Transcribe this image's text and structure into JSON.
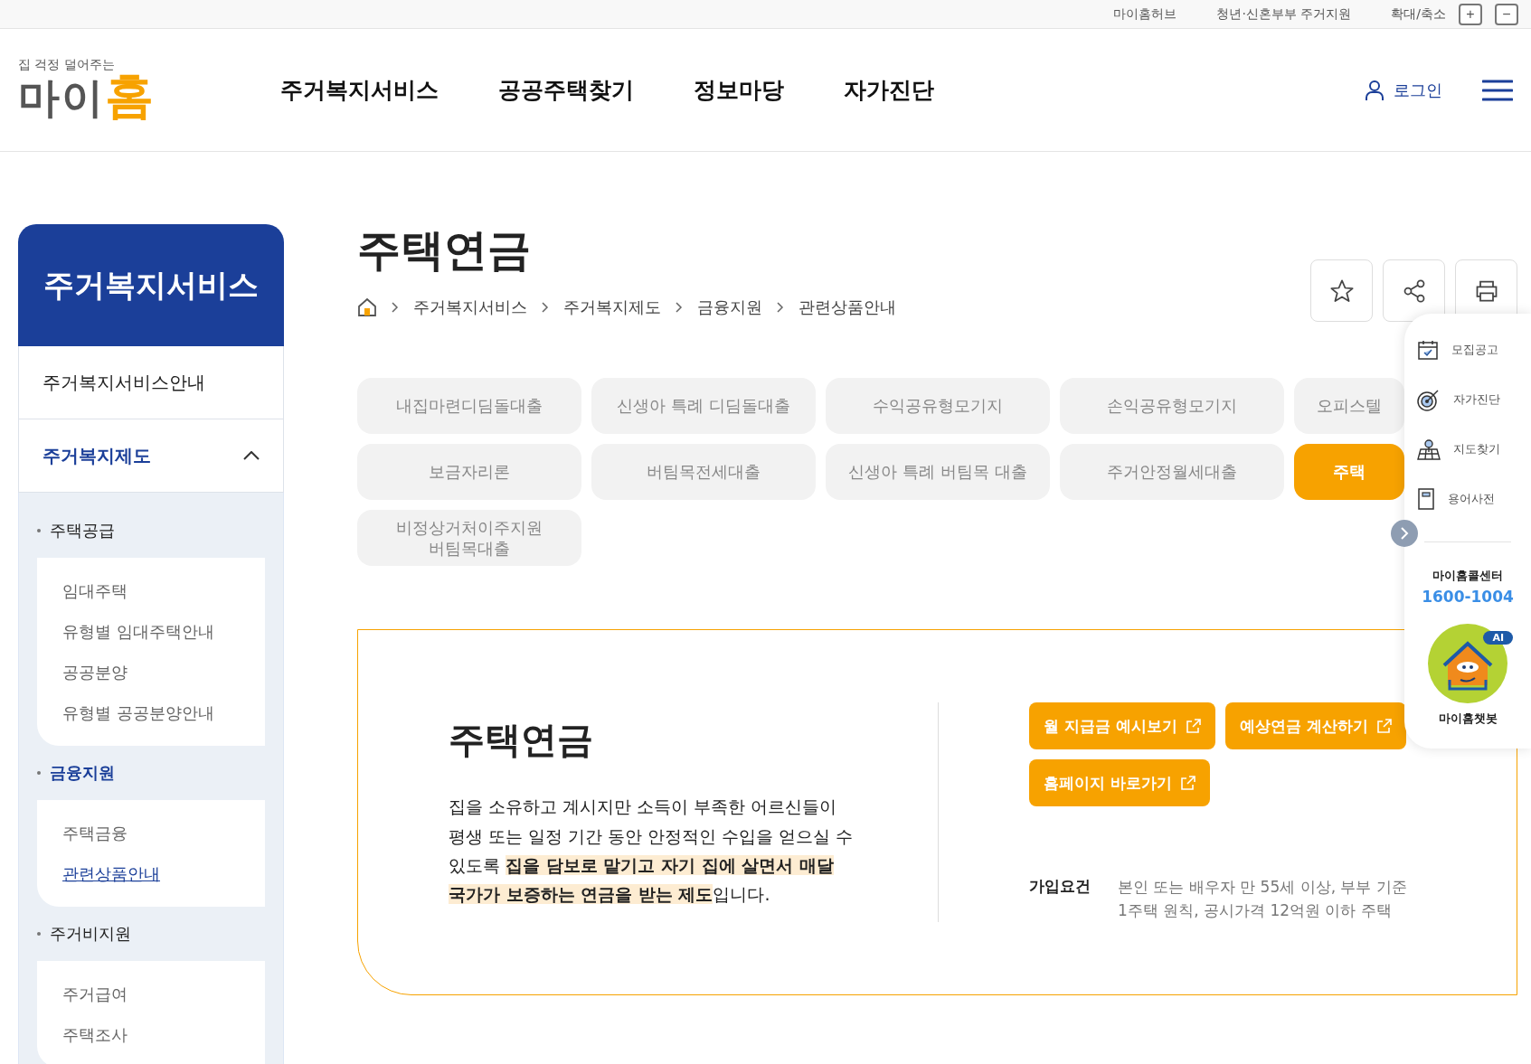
{
  "utility_bar": {
    "links": [
      "마이홈허브",
      "청년·신혼부부 주거지원"
    ],
    "zoom_label": "확대/축소",
    "zoom_in": "+",
    "zoom_out": "−"
  },
  "header": {
    "logo": {
      "tagline": "집 걱정 덜어주는",
      "name_main": "마이",
      "name_accent": "홈"
    },
    "nav": [
      "주거복지서비스",
      "공공주택찾기",
      "정보마당",
      "자가진단"
    ],
    "login": "로그인"
  },
  "sidebar": {
    "title": "주거복지서비스",
    "items": [
      {
        "label": "주거복지서비스안내",
        "selected": false
      },
      {
        "label": "주거복지제도",
        "expanded": true,
        "selected": true,
        "children": [
          {
            "label": "주택공급",
            "selected": false,
            "children": [
              {
                "label": "임대주택",
                "selected": false
              },
              {
                "label": "유형별 임대주택안내",
                "selected": false
              },
              {
                "label": "공공분양",
                "selected": false
              },
              {
                "label": "유형별 공공분양안내",
                "selected": false
              }
            ]
          },
          {
            "label": "금융지원",
            "selected": true,
            "children": [
              {
                "label": "주택금융",
                "selected": false
              },
              {
                "label": "관련상품안내",
                "selected": true
              }
            ]
          },
          {
            "label": "주거비지원",
            "selected": false,
            "children": [
              {
                "label": "주거급여",
                "selected": false
              },
              {
                "label": "주택조사",
                "selected": false
              }
            ]
          }
        ]
      }
    ]
  },
  "page": {
    "title": "주택연금",
    "breadcrumb": [
      "주거복지서비스",
      "주거복지제도",
      "금융지원",
      "관련상품안내"
    ],
    "tabs": [
      {
        "label": "내집마련디딤돌대출",
        "selected": false
      },
      {
        "label": "신생아 특례 디딤돌대출",
        "selected": false
      },
      {
        "label": "수익공유형모기지",
        "selected": false
      },
      {
        "label": "손익공유형모기지",
        "selected": false
      },
      {
        "label": "오피스텔",
        "selected": false
      },
      {
        "label": "보금자리론",
        "selected": false
      },
      {
        "label": "버팀목전세대출",
        "selected": false
      },
      {
        "label": "신생아 특례 버팀목 대출",
        "selected": false
      },
      {
        "label": "주거안정월세대출",
        "selected": false
      },
      {
        "label": "주택",
        "selected": true
      },
      {
        "label": "비정상거처이주지원\n버팀목대출",
        "selected": false
      }
    ],
    "card": {
      "title": "주택연금",
      "description": "집을 소유하고 계시지만 소득이 부족한 어르신들이 평생 또는 일정 기간 동안 안정적인 수입을 얻으실 수 있도록 **집을 담보로 맡기고 자기 집에 살면서 매달 국가가 보증하는 연금을 받는 제도**입니다.",
      "buttons": [
        "월 지급금 예시보기",
        "예상연금 계산하기",
        "홈페이지 바로가기"
      ],
      "requirement_label": "가입요건",
      "requirement_lines": [
        "본인 또는 배우자 만 55세 이상, 부부 기준",
        "1주택 원칙, 공시가격 12억원 이하 주택"
      ]
    }
  },
  "quick_menu": {
    "items": [
      "모집공고",
      "자가진단",
      "지도찾기",
      "용어사전"
    ],
    "call_center_label": "마이홈콜센터",
    "call_center_number": "1600-1004",
    "chatbot_badge": "AI",
    "chatbot_label": "마이홈챗봇"
  }
}
